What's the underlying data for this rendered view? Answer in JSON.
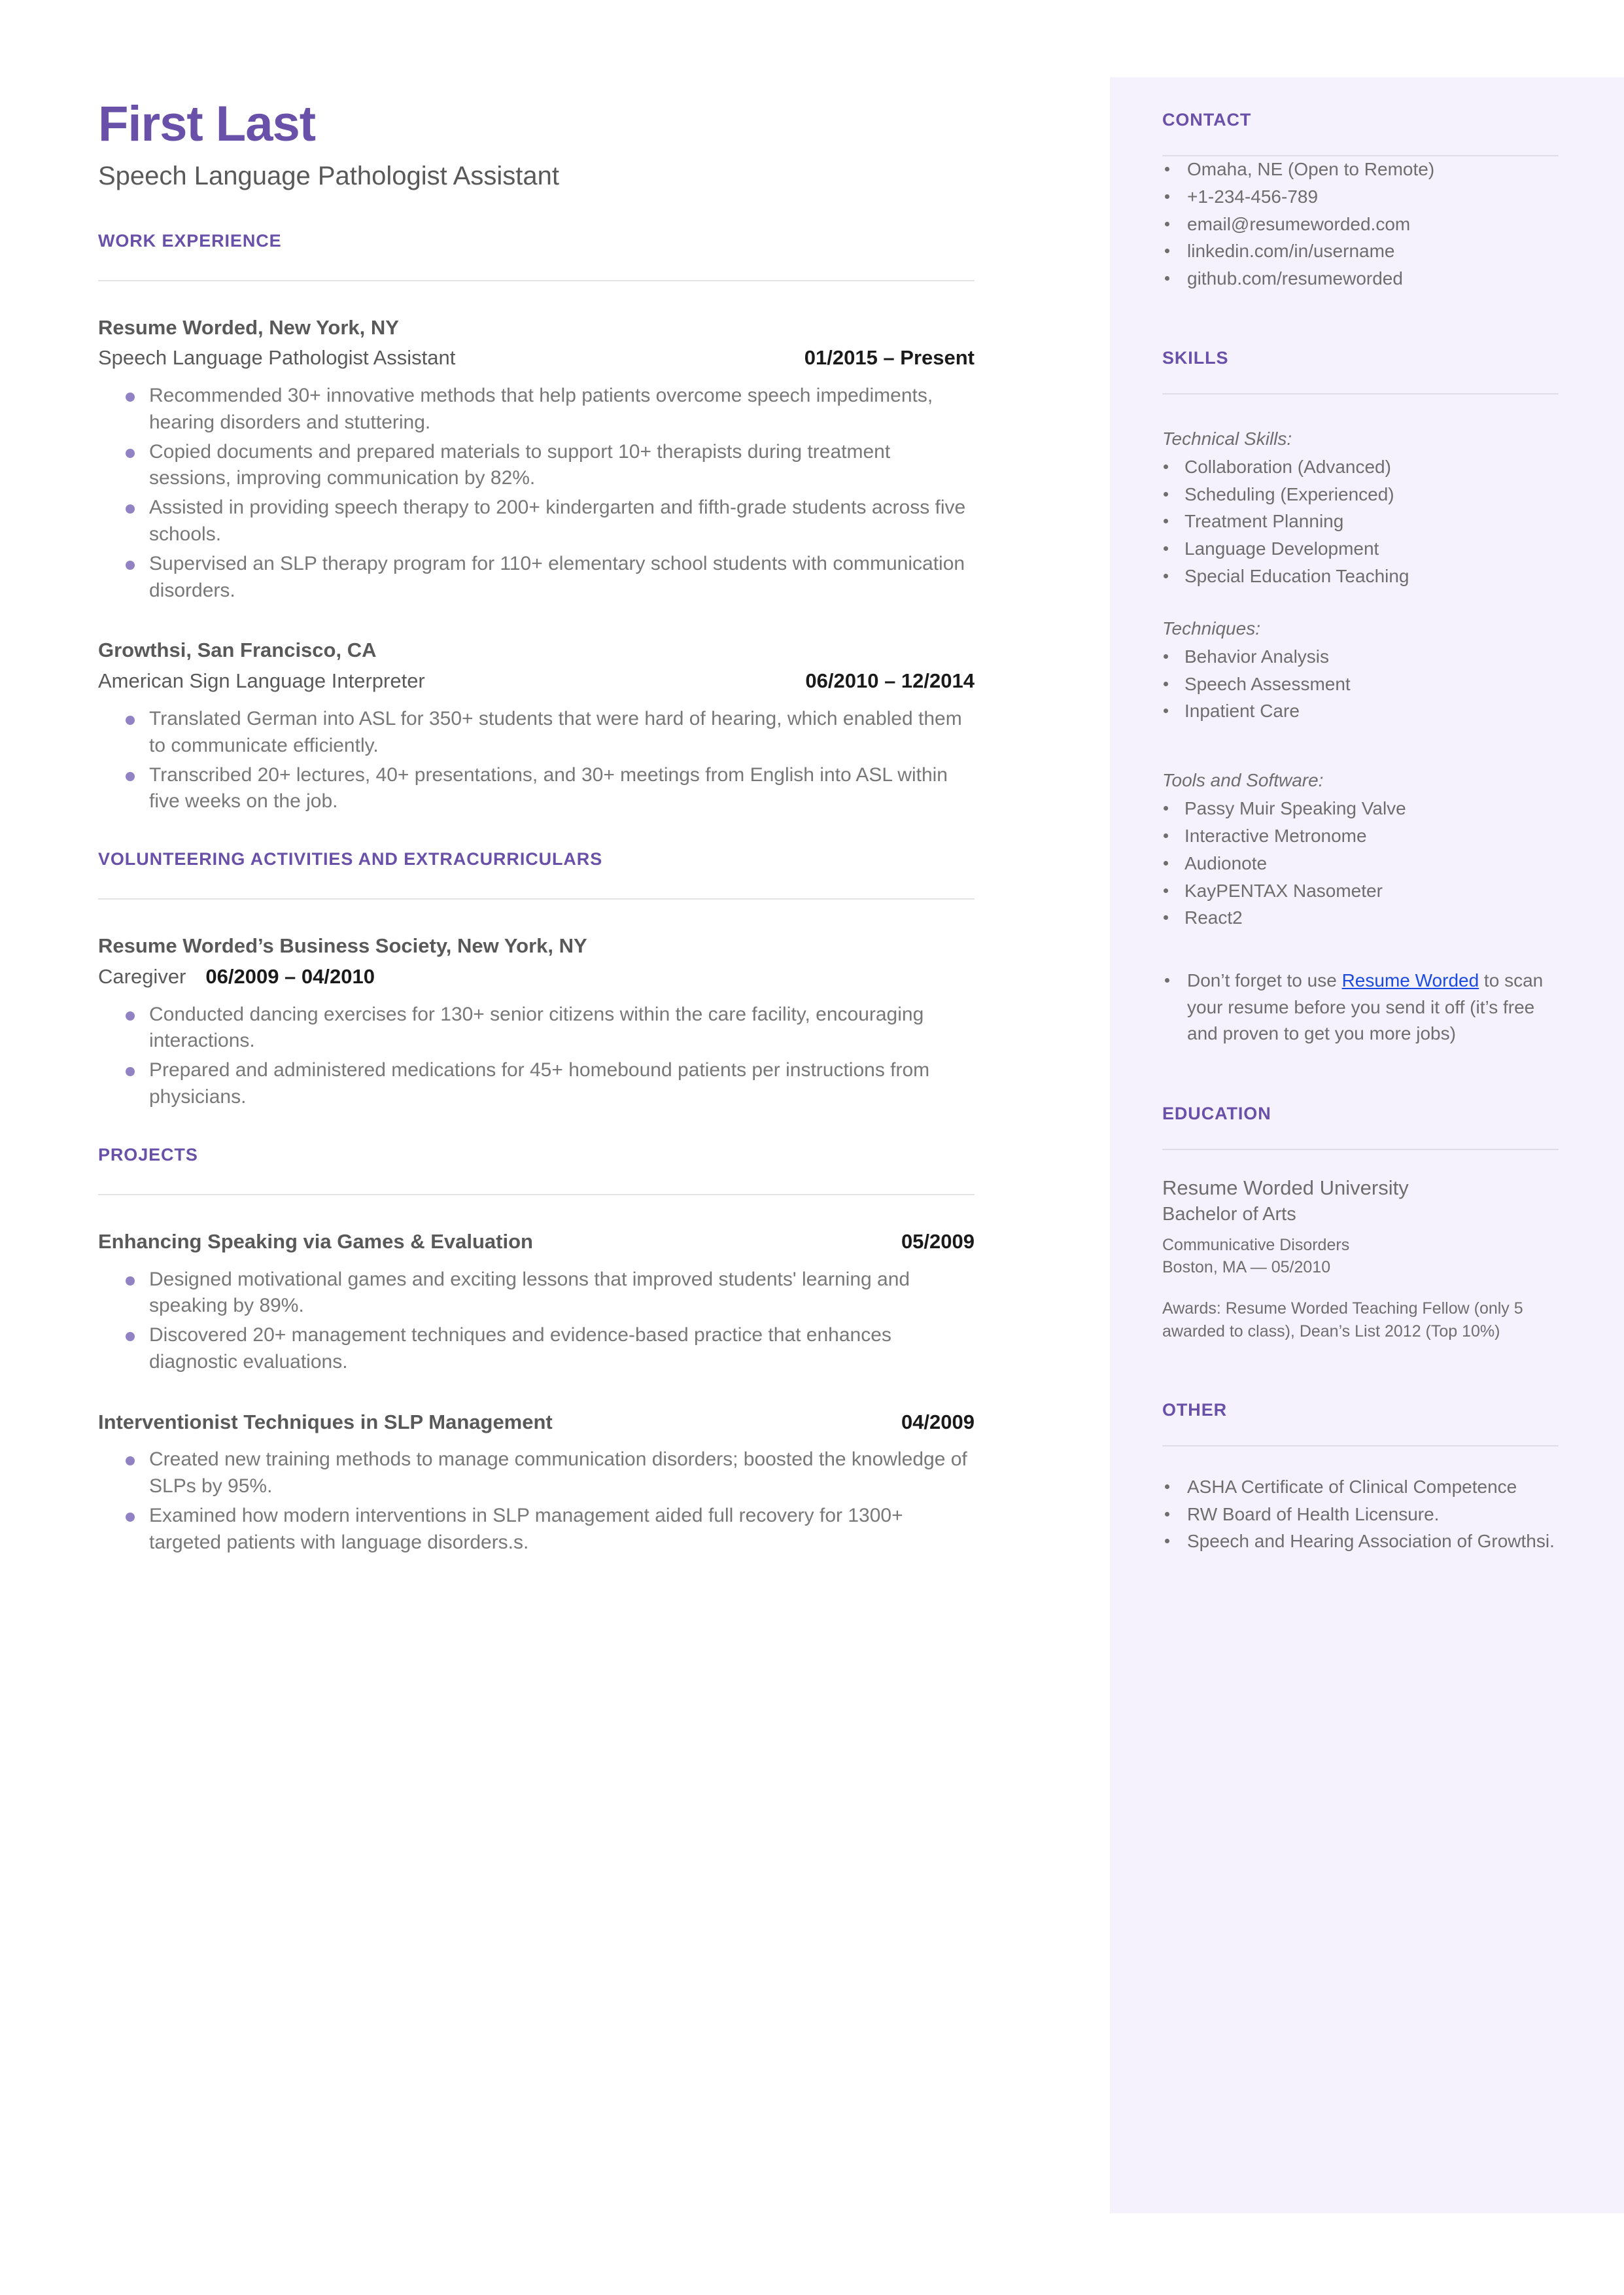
{
  "theme": {
    "accent_purple": "#6950a8",
    "bullet_purple": "#9182c4",
    "sidebar_bg": "#f5f2fd",
    "body_gray": "#787878",
    "link_blue": "#1a4ae0"
  },
  "header": {
    "name": "First Last",
    "headline": "Speech Language Pathologist Assistant"
  },
  "main": {
    "work": {
      "section_title": "WORK EXPERIENCE",
      "entries": [
        {
          "organization": "Resume Worded, New York, NY",
          "role": "Speech Language Pathologist Assistant",
          "dates": "01/2015 – Present",
          "bullets": [
            "Recommended 30+ innovative methods that help patients overcome speech impediments, hearing disorders and stuttering.",
            "Copied documents and prepared materials to support 10+ therapists during treatment sessions, improving communication by 82%.",
            "Assisted in providing speech therapy to 200+ kindergarten and fifth-grade students across five schools.",
            "Supervised an SLP therapy program for 110+ elementary school students with communication disorders."
          ]
        },
        {
          "organization": "Growthsi, San Francisco, CA",
          "role": "American Sign Language Interpreter",
          "dates": "06/2010 – 12/2014",
          "bullets": [
            "Translated German into ASL for 350+ students that were hard of hearing, which enabled them to communicate efficiently.",
            "Transcribed 20+ lectures, 40+ presentations, and 30+ meetings from English into ASL within five weeks on the job."
          ]
        }
      ]
    },
    "volunteering": {
      "section_title": "VOLUNTEERING ACTIVITIES AND EXTRACURRICULARS",
      "entries": [
        {
          "organization": "Resume Worded’s Business Society, New York, NY",
          "role": "Caregiver",
          "dates": "06/2009 – 04/2010",
          "bullets": [
            "Conducted dancing exercises for 130+ senior citizens within the care facility, encouraging interactions.",
            "Prepared and administered medications for 45+ homebound patients per instructions from physicians."
          ]
        }
      ]
    },
    "projects": {
      "section_title": "PROJECTS",
      "entries": [
        {
          "title": "Enhancing Speaking via Games & Evaluation",
          "dates": "05/2009",
          "bullets": [
            "Designed motivational games and exciting lessons that improved students' learning and speaking by 89%.",
            "Discovered 20+ management techniques and evidence-based practice that enhances diagnostic evaluations."
          ]
        },
        {
          "title": "Interventionist Techniques in SLP Management",
          "dates": "04/2009",
          "bullets": [
            "Created new training methods to manage communication disorders; boosted the knowledge of SLPs by 95%.",
            "Examined how modern interventions in SLP management aided full recovery for 1300+ targeted patients with language disorders.s."
          ]
        }
      ]
    }
  },
  "sidebar": {
    "contact": {
      "section_title": "CONTACT",
      "items": [
        "Omaha, NE (Open to Remote)",
        "+1-234-456-789",
        "email@resumeworded.com",
        "linkedin.com/in/username",
        "github.com/resumeworded"
      ]
    },
    "skills": {
      "section_title": "SKILLS",
      "groups": [
        {
          "label": "Technical Skills:",
          "items": [
            "Collaboration (Advanced)",
            "Scheduling (Experienced)",
            "Treatment Planning",
            "Language Development",
            "Special Education Teaching"
          ]
        },
        {
          "label": "Techniques:",
          "items": [
            "Behavior Analysis",
            "Speech Assessment",
            "Inpatient Care"
          ]
        },
        {
          "label": "Tools and Software:",
          "items": [
            "Passy Muir Speaking Valve",
            "Interactive Metronome",
            "Audionote",
            "KayPENTAX Nasometer",
            "React2"
          ]
        }
      ],
      "promo": {
        "before": "Don’t forget to use ",
        "link": "Resume Worded",
        "after": " to scan your resume before you send it off (it’s free and proven to get you more jobs)"
      }
    },
    "education": {
      "section_title": "EDUCATION",
      "school": "Resume Worded University",
      "degree": "Bachelor of Arts",
      "field": "Communicative Disorders",
      "location_date": "Boston, MA — 05/2010",
      "awards": "Awards: Resume Worded Teaching Fellow (only 5 awarded to class), Dean’s List 2012 (Top 10%)"
    },
    "other": {
      "section_title": "OTHER",
      "items": [
        "ASHA Certificate of Clinical Competence",
        "RW Board of Health Licensure.",
        "Speech and Hearing Association of Growthsi."
      ]
    }
  }
}
